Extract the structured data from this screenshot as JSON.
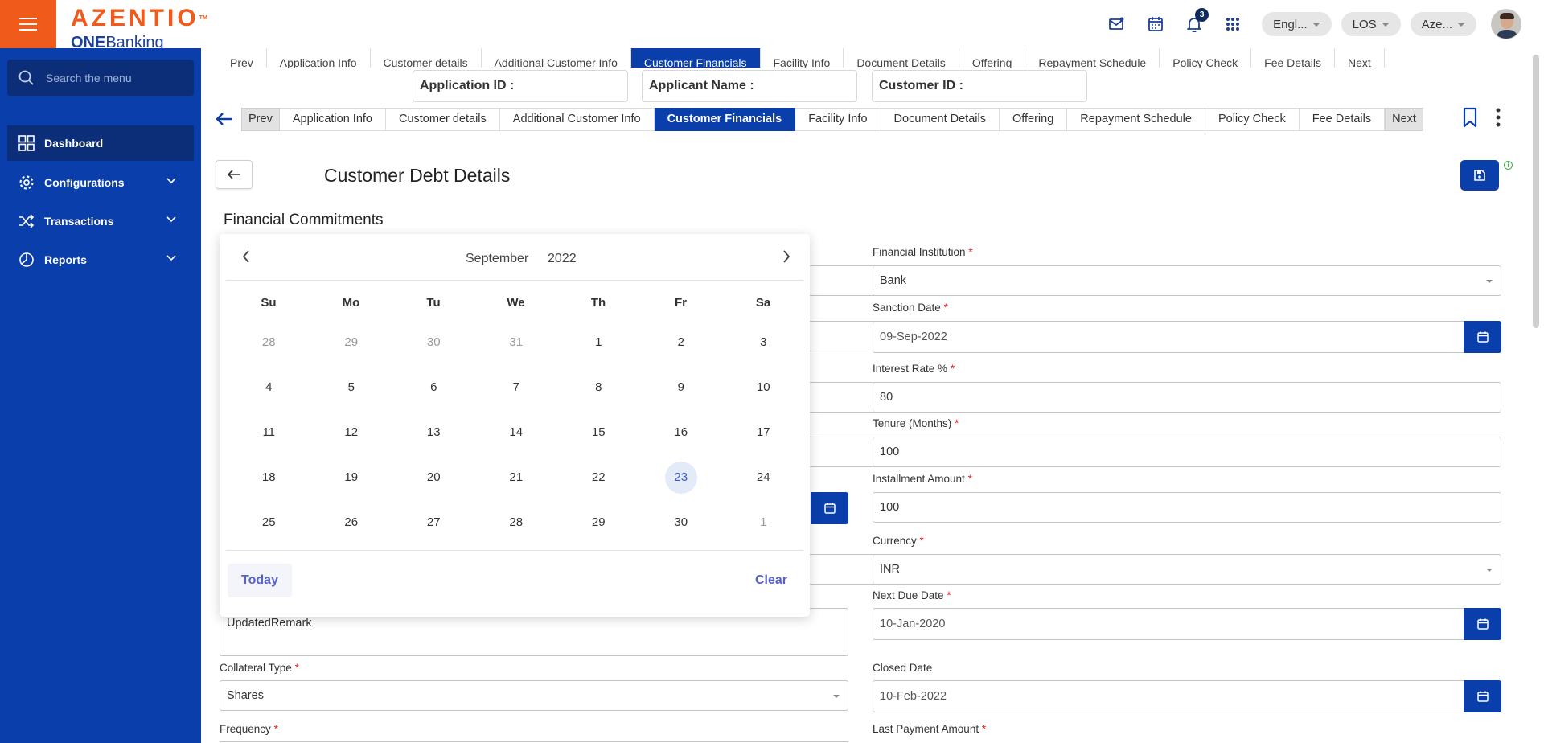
{
  "app": {
    "brand": "AZENTIO",
    "brand_tm": "TM",
    "product_one": "ONE",
    "product_banking": "Banking",
    "notification_count": "3",
    "lang_pill": "Engl...",
    "module_pill": "LOS",
    "entity_pill": "Aze...",
    "accent": "#0a3eab",
    "brand_color": "#f05a1a"
  },
  "sidebar": {
    "search_placeholder": "Search the menu",
    "items": [
      {
        "label": "Dashboard",
        "icon": "dashboard-icon"
      },
      {
        "label": "Configurations",
        "icon": "gear-icon"
      },
      {
        "label": "Transactions",
        "icon": "shuffle-icon"
      },
      {
        "label": "Reports",
        "icon": "pie-chart-icon"
      }
    ]
  },
  "ids": {
    "application_id": "Application ID :",
    "applicant_name": "Applicant Name :",
    "customer_id": "Customer ID :"
  },
  "tabs": {
    "prev": "Prev",
    "next": "Next",
    "items": [
      "Application Info",
      "Customer details",
      "Additional Customer Info",
      "Customer Financials",
      "Facility Info",
      "Document Details",
      "Offering",
      "Repayment Schedule",
      "Policy Check",
      "Fee Details"
    ],
    "active": "Customer Financials"
  },
  "page": {
    "title": "Customer Debt Details",
    "section": "Financial Commitments"
  },
  "form": {
    "financial_institution": {
      "label": "Financial Institution",
      "value": "Bank"
    },
    "sanction_date": {
      "label": "Sanction Date",
      "value": "09-Sep-2022"
    },
    "interest_rate": {
      "label": "Interest Rate %",
      "value": "80"
    },
    "tenure": {
      "label": "Tenure (Months)",
      "value": "100"
    },
    "installment_amount": {
      "label": "Installment Amount",
      "value": "100"
    },
    "currency": {
      "label": "Currency",
      "value": "INR"
    },
    "next_due_date": {
      "label": "Next Due Date",
      "value": "10-Jan-2020"
    },
    "closed_date": {
      "label": "Closed Date",
      "value": "10-Feb-2022"
    },
    "last_payment_amount": {
      "label": "Last Payment Amount"
    },
    "remarks": {
      "value": "UpdatedRemark"
    },
    "collateral_type": {
      "label": "Collateral Type",
      "value": "Shares"
    },
    "frequency": {
      "label": "Frequency"
    }
  },
  "datepicker": {
    "month": "September",
    "year": "2022",
    "weekdays": [
      "Su",
      "Mo",
      "Tu",
      "We",
      "Th",
      "Fr",
      "Sa"
    ],
    "weeks": [
      [
        "28",
        "29",
        "30",
        "31",
        "1",
        "2",
        "3"
      ],
      [
        "4",
        "5",
        "6",
        "7",
        "8",
        "9",
        "10"
      ],
      [
        "11",
        "12",
        "13",
        "14",
        "15",
        "16",
        "17"
      ],
      [
        "18",
        "19",
        "20",
        "21",
        "22",
        "23",
        "24"
      ],
      [
        "25",
        "26",
        "27",
        "28",
        "29",
        "30",
        "1"
      ]
    ],
    "selected": "23",
    "today_label": "Today",
    "clear_label": "Clear"
  }
}
